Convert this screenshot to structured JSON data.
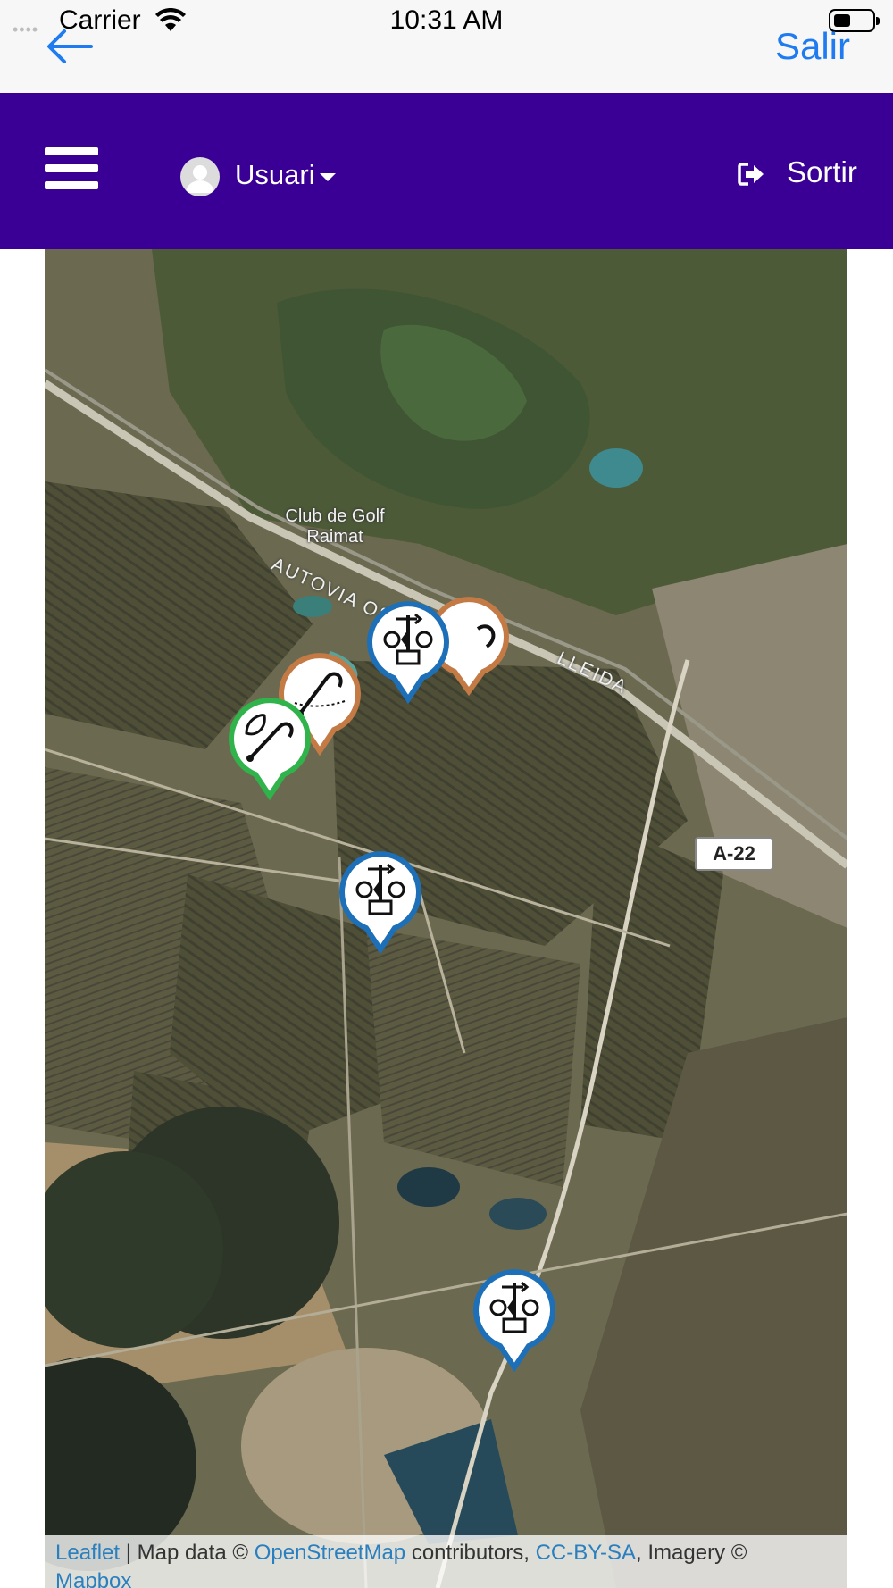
{
  "status_bar": {
    "carrier": "Carrier",
    "time": "10:31 AM",
    "battery_level": 0.35
  },
  "nav": {
    "back_icon": "back-arrow-icon",
    "exit_label": "Salir"
  },
  "app_bar": {
    "menu_icon": "hamburger-menu-icon",
    "user_label": "Usuari",
    "logout_label": "Sortir",
    "background_color": "#3a0096"
  },
  "map": {
    "place_labels": {
      "golf": "Club de Golf\nRaimat",
      "road_1": "AUTOVIA OSCA",
      "road_2": "A",
      "road_3": "LLEIDA",
      "highway_shield": "A-22"
    },
    "markers": [
      {
        "type": "weather-station",
        "color": "#1d6fb8"
      },
      {
        "type": "weather-station",
        "color": "#1d6fb8"
      },
      {
        "type": "weather-station",
        "color": "#1d6fb8"
      },
      {
        "type": "irrigation-sensor",
        "color": "#c47a45"
      },
      {
        "type": "irrigation-sensor",
        "color": "#c47a45"
      },
      {
        "type": "plant-sensor",
        "color": "#2fb34a"
      }
    ],
    "attribution": {
      "leaflet": "Leaflet",
      "sep1": " | Map data © ",
      "osm": "OpenStreetMap",
      "sep2": " contributors, ",
      "license": "CC-BY-SA",
      "sep3": ", Imagery ©",
      "mapbox": "Mapbox"
    }
  }
}
